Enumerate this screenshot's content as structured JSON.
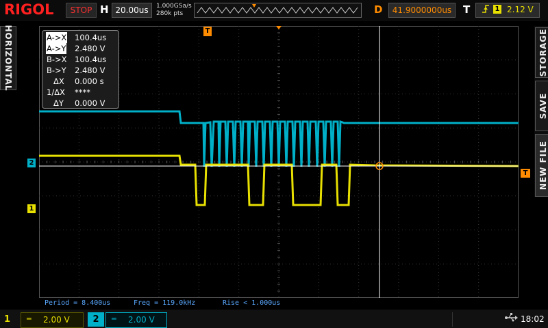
{
  "brand": {
    "logo": "RIGOL",
    "color": "#ff2020"
  },
  "topbar": {
    "run_status": "STOP",
    "horizontal_label": "H",
    "timebase": "20.00us",
    "sample_rate": "1.000GSa/s",
    "memory_depth": "280k pts",
    "delay_label": "D",
    "delay": "41.9000000us",
    "trigger_label": "T",
    "trigger_source": "1",
    "trigger_level": "2.12 V"
  },
  "side_menu": {
    "left": "HORIZONTAL",
    "right": [
      "STORAGE",
      "SAVE",
      "NEW FILE"
    ]
  },
  "markers": {
    "ch2": "2",
    "ch1": "1",
    "trigger": "T",
    "trigger_position": "T"
  },
  "cursor_panel": {
    "rows": [
      {
        "label": "A->X",
        "value": "100.4us",
        "highlight": true
      },
      {
        "label": "A->Y",
        "value": "2.480 V",
        "highlight": true
      },
      {
        "label": "B->X",
        "value": "100.4us",
        "highlight": false
      },
      {
        "label": "B->Y",
        "value": "2.480 V",
        "highlight": false
      },
      {
        "label": "ΔX",
        "value": "0.000 s",
        "highlight": false
      },
      {
        "label": "1/ΔX",
        "value": "****",
        "highlight": false
      },
      {
        "label": "ΔY",
        "value": "0.000 V",
        "highlight": false
      }
    ]
  },
  "measurements": [
    "Period = 8.400us",
    "Freq = 119.0kHz",
    "Rise < 1.000us"
  ],
  "channels": [
    {
      "number": "1",
      "coupling": "═",
      "scale": "2.00 V",
      "color": "#e8e000"
    },
    {
      "number": "2",
      "coupling": "═",
      "scale": "2.00 V",
      "color": "#00b0c8"
    }
  ],
  "status": {
    "usb_icon": "usb-icon",
    "time": "18:02"
  },
  "colors": {
    "ch1": "#e8e000",
    "ch2": "#00b0c8",
    "trigger": "#ff8c00",
    "measure": "#5aa8ff"
  }
}
